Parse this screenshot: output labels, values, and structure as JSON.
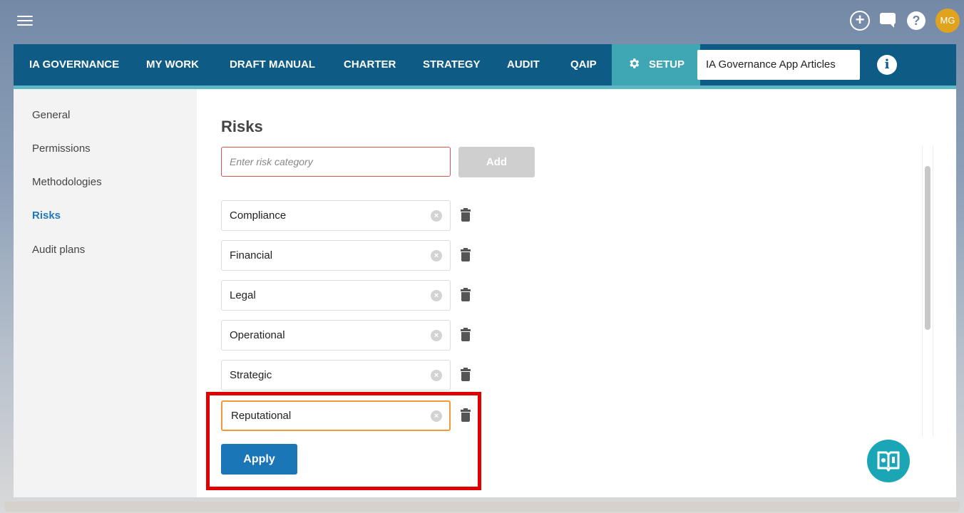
{
  "topbar": {
    "avatar_initials": "MG",
    "plus_symbol": "+",
    "help_symbol": "?",
    "icons": [
      "menu-icon",
      "add-circle-icon",
      "chat-icon",
      "help-icon",
      "avatar"
    ]
  },
  "nav": {
    "items": [
      "IA GOVERNANCE",
      "MY WORK",
      "DRAFT MANUAL",
      "CHARTER",
      "STRATEGY",
      "AUDIT",
      "QAIP"
    ],
    "setup_label": "SETUP",
    "search_value": "IA Governance App Articles",
    "info_symbol": "i"
  },
  "sidebar": {
    "items": [
      "General",
      "Permissions",
      "Methodologies",
      "Risks",
      "Audit plans"
    ],
    "active": "Risks"
  },
  "main": {
    "title": "Risks",
    "input_placeholder": "Enter risk category",
    "add_label": "Add",
    "risks": [
      "Compliance",
      "Financial",
      "Legal",
      "Operational",
      "Strategic",
      "Reputational"
    ],
    "clear_symbol": "×",
    "apply_label": "Apply"
  },
  "colors": {
    "nav_bg": "#0e5b86",
    "setup_bg": "#3fa6b4",
    "accent_blue": "#1b76b8",
    "highlight_red": "#e00000",
    "focus_orange": "#f09a3c",
    "avatar_bg": "#e0a31e"
  }
}
